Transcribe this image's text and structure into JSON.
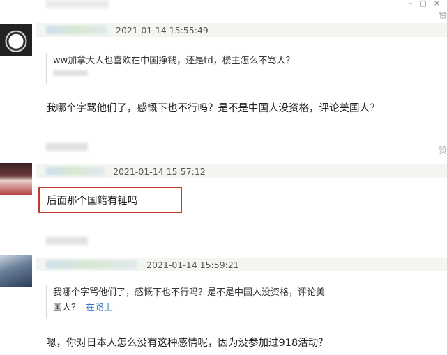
{
  "window": {
    "minimize": "–",
    "maximize": "□",
    "close": "×"
  },
  "comments": [
    {
      "timestamp": "2021-01-14 15:55:49",
      "quote": "ww加拿大人也喜欢在中国挣钱，还是td，楼主怎么不骂人？",
      "text": "我哪个字骂他们了，感慨下也不行吗？是不是中国人没资格，评论美国人？"
    },
    {
      "timestamp": "2021-01-14 15:57:12",
      "text": "后面那个国籍有锤吗"
    },
    {
      "timestamp": "2021-01-14 15:59:21",
      "quote_line1": "我哪个字骂他们了，感慨下也不行吗？是不是中国人没资格，评论美",
      "quote_line2": "国人？",
      "quote_user": "在路上",
      "text": "嗯，你对日本人怎么没有这种感情呢，因为没参加过918活动？"
    }
  ],
  "edge_glyph": "赞"
}
